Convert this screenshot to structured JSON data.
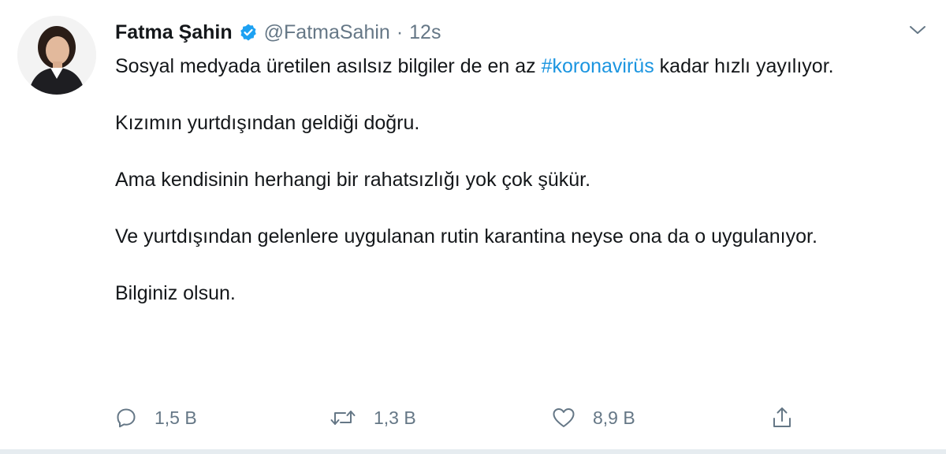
{
  "tweet": {
    "author_name": "Fatma Şahin",
    "author_handle": "@FatmaSahin",
    "separator": "·",
    "timestamp": "12s",
    "text": {
      "para1_before_hashtag": "Sosyal medyada üretilen asılsız bilgiler de en az ",
      "hashtag": "#koronavirüs",
      "para1_after_hashtag": " kadar hızlı yayılıyor.",
      "para2": "Kızımın yurtdışından geldiği doğru.",
      "para3": "Ama kendisinin herhangi bir rahatsızlığı yok çok şükür.",
      "para4": "Ve yurtdışından gelenlere uygulanan rutin karantina neyse ona da o uygulanıyor.",
      "para5": "Bilginiz olsun."
    },
    "actions": {
      "reply_count": "1,5 B",
      "retweet_count": "1,3 B",
      "like_count": "8,9 B"
    },
    "icons": {
      "verified": "verified-badge-icon",
      "menu": "chevron-down-icon",
      "reply": "reply-icon",
      "retweet": "retweet-icon",
      "like": "heart-icon",
      "share": "share-icon"
    },
    "colors": {
      "hashtag": "#1b95e0",
      "verified": "#1da1f2",
      "secondary_text": "#657786"
    }
  }
}
